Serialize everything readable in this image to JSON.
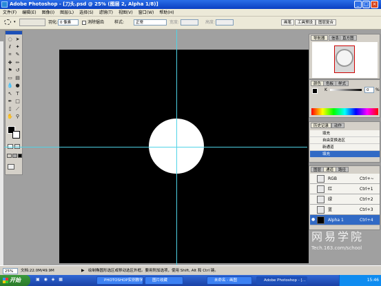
{
  "window": {
    "title": "Adobe Photoshop - [刀头.psd @ 25% (图层 2, Alpha 1/8)]",
    "controls": [
      "_",
      "□",
      "×"
    ]
  },
  "menubar": {
    "items": [
      "文件(F)",
      "编辑(E)",
      "图像(I)",
      "图层(L)",
      "选择(S)",
      "滤镜(T)",
      "视图(V)",
      "窗口(W)",
      "帮助(H)"
    ]
  },
  "options": {
    "feather_label": "羽化:",
    "feather_value": "0 像素",
    "antialias_label": "消除锯齿",
    "style_label": "样式:",
    "style_value": "正常",
    "width_label": "宽度:",
    "height_label": "高度:",
    "tabs": [
      "画笔",
      "工具预设",
      "图层复合"
    ]
  },
  "panels": {
    "navigator": {
      "tabs": [
        "导航器",
        "信息",
        "直方图"
      ]
    },
    "color": {
      "tabs": [
        "颜色",
        "色板",
        "样式"
      ],
      "slider_label": "K",
      "slider_value": "0",
      "unit": "%"
    },
    "history": {
      "tabs": [
        "历史记录",
        "动作"
      ],
      "rows": [
        "填充",
        "自由变换选区",
        "新通道",
        "填充"
      ]
    },
    "channels": {
      "tabs": [
        "图层",
        "通道",
        "路径"
      ],
      "rows": [
        {
          "name": "RGB",
          "shortcut": "Ctrl+~"
        },
        {
          "name": "红",
          "shortcut": "Ctrl+1"
        },
        {
          "name": "绿",
          "shortcut": "Ctrl+2"
        },
        {
          "name": "蓝",
          "shortcut": "Ctrl+3"
        },
        {
          "name": "Alpha 1",
          "shortcut": "Ctrl+4"
        }
      ]
    }
  },
  "watermark": {
    "cn": "网易学院",
    "url": "Tech.163.com/school"
  },
  "status": {
    "zoom": "25%",
    "doc": "文档:22.0M/49.9M",
    "hint": "绘制椭圆形选区或移动选区外框。要用附加选项，使用 Shift, Alt 和 Ctrl 键。"
  },
  "taskbar": {
    "start": "开始",
    "tasks": [
      "PHOTOSHOP实例教学",
      "图片收藏",
      "未命名 - 画图",
      "Adobe Photoshop - [..."
    ],
    "time": "15:46"
  }
}
